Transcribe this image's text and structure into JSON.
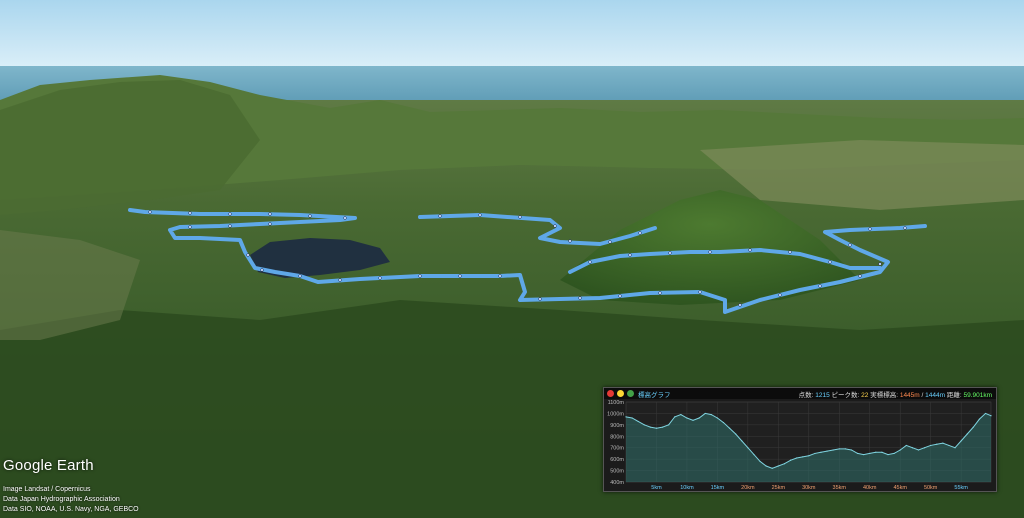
{
  "credits": {
    "logo": "Google Earth",
    "line1": "Image Landsat / Copernicus",
    "line2": "Data Japan Hydrographic Association",
    "line3": "Data SIO, NOAA, U.S. Navy, NGA, GEBCO"
  },
  "colors": {
    "sky": "#bfe3f5",
    "sea": "#5f9db8",
    "track": "#5fa8e8",
    "chart_line": "#7fd4e0",
    "dot_red": "#e53935",
    "dot_yellow": "#fdd835",
    "dot_green": "#43a047"
  },
  "window_controls": {
    "close_icon": "red-dot-icon",
    "minimize_icon": "yellow-dot-icon",
    "maximize_icon": "green-dot-icon"
  },
  "elevation_panel": {
    "title": "標高グラフ",
    "points_label": "点数:",
    "points_value": "1215",
    "peaks_label": "ピーク数:",
    "peaks_value": "22",
    "elev_label": "実標標高:",
    "elev_max": "1445m",
    "elev_sep": "/",
    "elev_max2": "1444m",
    "dist_label": "距離:",
    "dist_value": "59.901km"
  },
  "chart_data": {
    "type": "area",
    "title": "標高グラフ",
    "xlabel": "",
    "ylabel": "",
    "x_ticks": [
      "5km",
      "10km",
      "15km",
      "20km",
      "25km",
      "30km",
      "35km",
      "40km",
      "45km",
      "50km",
      "55km"
    ],
    "y_ticks": [
      "400m",
      "500m",
      "600m",
      "700m",
      "800m",
      "900m",
      "1000m",
      "1100m"
    ],
    "xlim": [
      0,
      59.9
    ],
    "ylim": [
      400,
      1100
    ],
    "series": [
      {
        "values_x": [
          0,
          1,
          2,
          3,
          4,
          5,
          6,
          7,
          8,
          9,
          10,
          11,
          12,
          13,
          14,
          15,
          16,
          17,
          18,
          19,
          20,
          21,
          22,
          23,
          24,
          25,
          26,
          27,
          28,
          29,
          30,
          31,
          32,
          33,
          34,
          35,
          36,
          37,
          38,
          39,
          40,
          41,
          42,
          43,
          44,
          45,
          46,
          47,
          48,
          49,
          50,
          51,
          52,
          53,
          54,
          55,
          56,
          57,
          58,
          59,
          59.9
        ],
        "values_y": [
          970,
          960,
          930,
          900,
          880,
          870,
          880,
          900,
          970,
          990,
          960,
          940,
          960,
          1000,
          990,
          960,
          920,
          870,
          820,
          760,
          700,
          640,
          580,
          540,
          520,
          540,
          560,
          590,
          610,
          620,
          630,
          650,
          660,
          670,
          680,
          690,
          690,
          680,
          650,
          640,
          650,
          660,
          660,
          640,
          650,
          680,
          720,
          700,
          680,
          700,
          720,
          730,
          740,
          720,
          700,
          760,
          820,
          880,
          950,
          1000,
          980
        ]
      }
    ]
  }
}
